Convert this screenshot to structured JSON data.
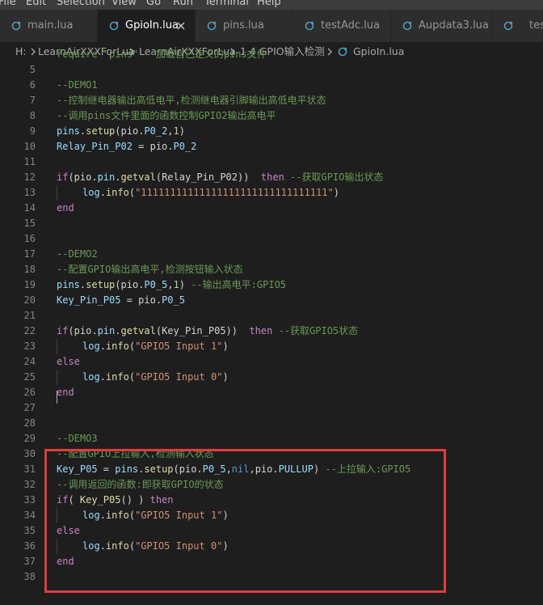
{
  "menu": [
    "File",
    "Edit",
    "Selection",
    "View",
    "Go",
    "Run",
    "Terminal",
    "Help"
  ],
  "tabs": [
    {
      "label": "main.lua",
      "active": false
    },
    {
      "label": "GpioIn.lua",
      "active": true
    },
    {
      "label": "pins.lua",
      "active": false
    },
    {
      "label": "testAdc.lua",
      "active": false
    },
    {
      "label": "Aupdata3.lua",
      "active": false
    },
    {
      "label": "tes",
      "active": false
    }
  ],
  "colors": {
    "lua_icon": "#519aba",
    "highlight_border": "#e03c3c",
    "comment": "#6a9955",
    "keyword": "#569cd6",
    "string": "#ce9178"
  },
  "icons": {
    "tab_file": "lua-file-icon",
    "close": "close-icon",
    "breadcrumb_sep": "chevron-right-icon"
  },
  "breadcrumb": [
    "H:",
    "LearnAirXXXForLua",
    "LearnAirXXXForLua",
    "1.4 GPIO输入检测",
    "GpioIn.lua"
  ],
  "editor": {
    "lines": [
      {
        "n": "",
        "indent": false,
        "tokens": [
          {
            "t": "require \"pins\" --加载自己定义的pins文件",
            "c": "tok-cm"
          }
        ]
      },
      {
        "n": "5",
        "indent": false,
        "tokens": []
      },
      {
        "n": "6",
        "indent": false,
        "tokens": [
          {
            "t": "--DEMO1",
            "c": "tok-cm"
          }
        ]
      },
      {
        "n": "7",
        "indent": false,
        "tokens": [
          {
            "t": "--控制继电器输出高低电平,检测继电器引脚输出高低电平状态",
            "c": "tok-cm"
          }
        ]
      },
      {
        "n": "8",
        "indent": false,
        "tokens": [
          {
            "t": "--调用pins文件里面的函数控制GPIO2输出高电平",
            "c": "tok-cm"
          }
        ]
      },
      {
        "n": "9",
        "indent": false,
        "tokens": [
          {
            "t": "pins",
            "c": "tok-var"
          },
          {
            "t": ".",
            "c": "tok-plain"
          },
          {
            "t": "setup",
            "c": "tok-fn"
          },
          {
            "t": "(pio.",
            "c": "tok-plain"
          },
          {
            "t": "P0_2",
            "c": "tok-var"
          },
          {
            "t": ",",
            "c": "tok-plain"
          },
          {
            "t": "1",
            "c": "tok-num"
          },
          {
            "t": ")",
            "c": "tok-plain"
          }
        ]
      },
      {
        "n": "10",
        "indent": false,
        "tokens": [
          {
            "t": "Relay_Pin_P02",
            "c": "tok-var"
          },
          {
            "t": " = pio.",
            "c": "tok-plain"
          },
          {
            "t": "P0_2",
            "c": "tok-var"
          }
        ]
      },
      {
        "n": "11",
        "indent": false,
        "tokens": []
      },
      {
        "n": "12",
        "indent": false,
        "tokens": [
          {
            "t": "if",
            "c": "tok-kwc"
          },
          {
            "t": "(pio.",
            "c": "tok-plain"
          },
          {
            "t": "pin",
            "c": "tok-var"
          },
          {
            "t": ".",
            "c": "tok-plain"
          },
          {
            "t": "getval",
            "c": "tok-fn"
          },
          {
            "t": "(Relay_Pin_P02))  ",
            "c": "tok-plain"
          },
          {
            "t": "then",
            "c": "tok-kwc"
          },
          {
            "t": " --获取GPIO输出状态",
            "c": "tok-cm"
          }
        ]
      },
      {
        "n": "13",
        "indent": true,
        "tokens": [
          {
            "t": "log",
            "c": "tok-var"
          },
          {
            "t": ".",
            "c": "tok-plain"
          },
          {
            "t": "info",
            "c": "tok-fn"
          },
          {
            "t": "(",
            "c": "tok-plain"
          },
          {
            "t": "\"11111111111111111111111111111111\"",
            "c": "tok-str"
          },
          {
            "t": ")",
            "c": "tok-plain"
          }
        ]
      },
      {
        "n": "14",
        "indent": false,
        "tokens": [
          {
            "t": "end",
            "c": "tok-kwc"
          }
        ]
      },
      {
        "n": "15",
        "indent": false,
        "tokens": []
      },
      {
        "n": "16",
        "indent": false,
        "tokens": []
      },
      {
        "n": "17",
        "indent": false,
        "tokens": [
          {
            "t": "--DEMO2",
            "c": "tok-cm"
          }
        ]
      },
      {
        "n": "18",
        "indent": false,
        "tokens": [
          {
            "t": "--配置GPIO输出高电平,检测按钮输入状态",
            "c": "tok-cm"
          }
        ]
      },
      {
        "n": "19",
        "indent": false,
        "tokens": [
          {
            "t": "pins",
            "c": "tok-var"
          },
          {
            "t": ".",
            "c": "tok-plain"
          },
          {
            "t": "setup",
            "c": "tok-fn"
          },
          {
            "t": "(pio.",
            "c": "tok-plain"
          },
          {
            "t": "P0_5",
            "c": "tok-var"
          },
          {
            "t": ",",
            "c": "tok-plain"
          },
          {
            "t": "1",
            "c": "tok-num"
          },
          {
            "t": ") ",
            "c": "tok-plain"
          },
          {
            "t": "--输出高电平:GPIO5",
            "c": "tok-cm"
          }
        ]
      },
      {
        "n": "20",
        "indent": false,
        "tokens": [
          {
            "t": "Key_Pin_P05",
            "c": "tok-var"
          },
          {
            "t": " = pio.",
            "c": "tok-plain"
          },
          {
            "t": "P0_5",
            "c": "tok-var"
          }
        ]
      },
      {
        "n": "21",
        "indent": false,
        "tokens": []
      },
      {
        "n": "22",
        "indent": false,
        "tokens": [
          {
            "t": "if",
            "c": "tok-kwc"
          },
          {
            "t": "(pio.",
            "c": "tok-plain"
          },
          {
            "t": "pin",
            "c": "tok-var"
          },
          {
            "t": ".",
            "c": "tok-plain"
          },
          {
            "t": "getval",
            "c": "tok-fn"
          },
          {
            "t": "(Key_Pin_P05))  ",
            "c": "tok-plain"
          },
          {
            "t": "then",
            "c": "tok-kwc"
          },
          {
            "t": " --获取GPIO5状态",
            "c": "tok-cm"
          }
        ]
      },
      {
        "n": "23",
        "indent": true,
        "tokens": [
          {
            "t": "log",
            "c": "tok-var"
          },
          {
            "t": ".",
            "c": "tok-plain"
          },
          {
            "t": "info",
            "c": "tok-fn"
          },
          {
            "t": "(",
            "c": "tok-plain"
          },
          {
            "t": "\"GPIO5 Input 1\"",
            "c": "tok-str"
          },
          {
            "t": ")",
            "c": "tok-plain"
          }
        ]
      },
      {
        "n": "24",
        "indent": false,
        "tokens": [
          {
            "t": "else",
            "c": "tok-kwc"
          }
        ]
      },
      {
        "n": "25",
        "indent": true,
        "tokens": [
          {
            "t": "log",
            "c": "tok-var"
          },
          {
            "t": ".",
            "c": "tok-plain"
          },
          {
            "t": "info",
            "c": "tok-fn"
          },
          {
            "t": "(",
            "c": "tok-plain"
          },
          {
            "t": "\"GPIO5 Input 0\"",
            "c": "tok-str"
          },
          {
            "t": ")",
            "c": "tok-plain"
          }
        ]
      },
      {
        "n": "26",
        "indent": false,
        "tokens": [
          {
            "t": "end",
            "c": "tok-kwc"
          }
        ]
      },
      {
        "n": "27",
        "indent": false,
        "tokens": []
      },
      {
        "n": "28",
        "indent": false,
        "tokens": []
      },
      {
        "n": "29",
        "indent": false,
        "tokens": [
          {
            "t": "--DEMO3",
            "c": "tok-cm"
          }
        ]
      },
      {
        "n": "30",
        "indent": false,
        "tokens": [
          {
            "t": "--配置GPIO上拉输入,检测输入状态",
            "c": "tok-cm"
          }
        ]
      },
      {
        "n": "31",
        "indent": false,
        "tokens": [
          {
            "t": "Key_P05",
            "c": "tok-var"
          },
          {
            "t": " = ",
            "c": "tok-plain"
          },
          {
            "t": "pins",
            "c": "tok-var"
          },
          {
            "t": ".",
            "c": "tok-plain"
          },
          {
            "t": "setup",
            "c": "tok-fn"
          },
          {
            "t": "(pio.",
            "c": "tok-plain"
          },
          {
            "t": "P0_5",
            "c": "tok-var"
          },
          {
            "t": ",",
            "c": "tok-plain"
          },
          {
            "t": "nil",
            "c": "tok-kw"
          },
          {
            "t": ",pio.",
            "c": "tok-plain"
          },
          {
            "t": "PULLUP",
            "c": "tok-var"
          },
          {
            "t": ") ",
            "c": "tok-plain"
          },
          {
            "t": "--上拉输入:GPIO5",
            "c": "tok-cm"
          }
        ]
      },
      {
        "n": "32",
        "indent": false,
        "tokens": [
          {
            "t": "--调用返回的函数:即获取GPIO的状态",
            "c": "tok-cm"
          }
        ]
      },
      {
        "n": "33",
        "indent": false,
        "tokens": [
          {
            "t": "if",
            "c": "tok-kwc"
          },
          {
            "t": "( ",
            "c": "tok-plain"
          },
          {
            "t": "Key_P05",
            "c": "tok-fn"
          },
          {
            "t": "() ) ",
            "c": "tok-plain"
          },
          {
            "t": "then",
            "c": "tok-kwc"
          }
        ]
      },
      {
        "n": "34",
        "indent": true,
        "tokens": [
          {
            "t": "log",
            "c": "tok-var"
          },
          {
            "t": ".",
            "c": "tok-plain"
          },
          {
            "t": "info",
            "c": "tok-fn"
          },
          {
            "t": "(",
            "c": "tok-plain"
          },
          {
            "t": "\"GPIO5 Input 1\"",
            "c": "tok-str"
          },
          {
            "t": ")",
            "c": "tok-plain"
          }
        ]
      },
      {
        "n": "35",
        "indent": false,
        "tokens": [
          {
            "t": "else",
            "c": "tok-kwc"
          }
        ]
      },
      {
        "n": "36",
        "indent": true,
        "tokens": [
          {
            "t": "log",
            "c": "tok-var"
          },
          {
            "t": ".",
            "c": "tok-plain"
          },
          {
            "t": "info",
            "c": "tok-fn"
          },
          {
            "t": "(",
            "c": "tok-plain"
          },
          {
            "t": "\"GPIO5 Input 0\"",
            "c": "tok-str"
          },
          {
            "t": ")",
            "c": "tok-plain"
          }
        ]
      },
      {
        "n": "37",
        "indent": false,
        "tokens": [
          {
            "t": "end",
            "c": "tok-kwc"
          }
        ]
      },
      {
        "n": "38",
        "indent": false,
        "tokens": []
      }
    ]
  }
}
